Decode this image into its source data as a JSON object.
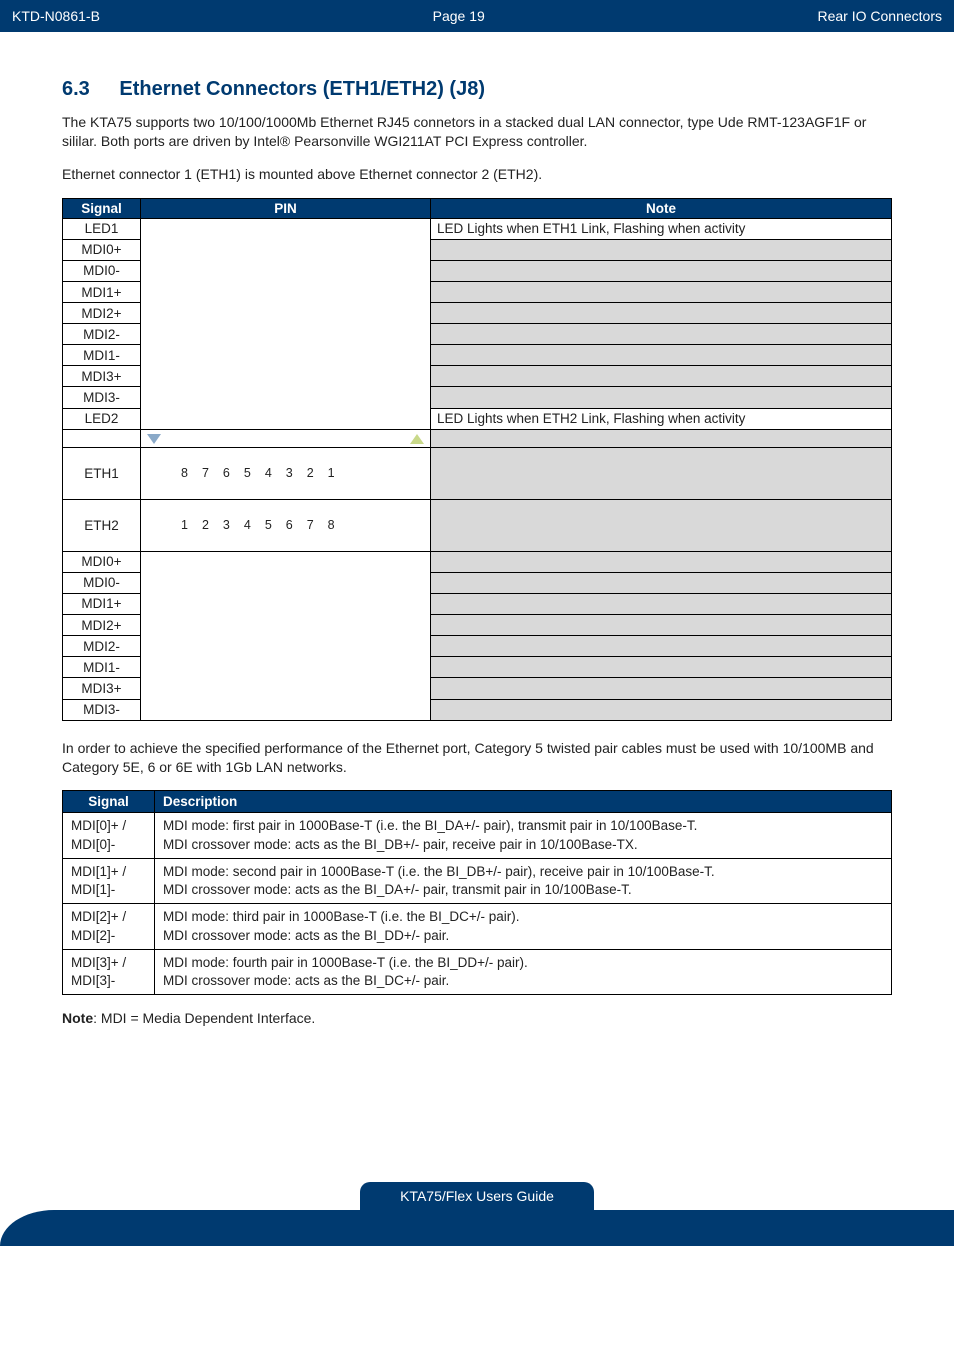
{
  "header": {
    "doc_code": "KTD-N0861-B",
    "page_label": "Page 19",
    "section_title": "Rear IO Connectors"
  },
  "section": {
    "number": "6.3",
    "title": "Ethernet Connectors (ETH1/ETH2) (J8)"
  },
  "intro_p1": "The KTA75 supports two 10/100/1000Mb Ethernet RJ45 connetors in a stacked dual LAN connector, type Ude RMT-123AGF1F or sililar. Both ports are driven by Intel® Pearsonville WGI211AT PCI Express controller.",
  "intro_p2": "Ethernet connector 1 (ETH1) is mounted above Ethernet connector 2 (ETH2).",
  "pin_table": {
    "headers": {
      "signal": "Signal",
      "pin": "PIN",
      "note": "Note"
    },
    "rows_top": [
      {
        "signal": "LED1",
        "note": "LED Lights when ETH1 Link, Flashing when activity",
        "note_light": true
      },
      {
        "signal": "MDI0+",
        "note": ""
      },
      {
        "signal": "MDI0-",
        "note": ""
      },
      {
        "signal": "MDI1+",
        "note": ""
      },
      {
        "signal": "MDI2+",
        "note": ""
      },
      {
        "signal": "MDI2-",
        "note": ""
      },
      {
        "signal": "MDI1-",
        "note": ""
      },
      {
        "signal": "MDI3+",
        "note": ""
      },
      {
        "signal": "MDI3-",
        "note": ""
      },
      {
        "signal": "LED2",
        "note": "LED Lights when ETH2 Link, Flashing when activity",
        "note_light": true
      }
    ],
    "arrow_row_label": "",
    "eth1": {
      "label": "ETH1",
      "pins": [
        "8",
        "7",
        "6",
        "5",
        "4",
        "3",
        "2",
        "1"
      ]
    },
    "eth2": {
      "label": "ETH2",
      "pins": [
        "1",
        "2",
        "3",
        "4",
        "5",
        "6",
        "7",
        "8"
      ]
    },
    "rows_bottom": [
      {
        "signal": "MDI0+",
        "note": ""
      },
      {
        "signal": "MDI0-",
        "note": ""
      },
      {
        "signal": "MDI1+",
        "note": ""
      },
      {
        "signal": "MDI2+",
        "note": ""
      },
      {
        "signal": "MDI2-",
        "note": ""
      },
      {
        "signal": "MDI1-",
        "note": ""
      },
      {
        "signal": "MDI3+",
        "note": ""
      },
      {
        "signal": "MDI3-",
        "note": ""
      }
    ]
  },
  "after_table_p": "In order to achieve the specified performance of the Ethernet port, Category 5 twisted pair cables must be used with 10/100MB and Category 5E, 6 or 6E with 1Gb LAN networks.",
  "desc_table": {
    "headers": {
      "signal": "Signal",
      "description": "Description"
    },
    "rows": [
      {
        "signal_a": "MDI[0]+ /",
        "signal_b": "MDI[0]-",
        "line1": "MDI mode: first pair in 1000Base-T (i.e. the BI_DA+/- pair), transmit pair in 10/100Base-T.",
        "line2": "MDI crossover mode: acts as the BI_DB+/- pair, receive pair in 10/100Base-TX."
      },
      {
        "signal_a": "MDI[1]+ /",
        "signal_b": "MDI[1]-",
        "line1": "MDI mode: second pair in 1000Base-T (i.e. the BI_DB+/- pair), receive pair in 10/100Base-T.",
        "line2": "MDI crossover mode: acts as the BI_DA+/- pair, transmit pair in 10/100Base-T."
      },
      {
        "signal_a": "MDI[2]+ /",
        "signal_b": "MDI[2]-",
        "line1": "MDI mode: third pair in 1000Base-T (i.e. the BI_DC+/- pair).",
        "line2": "MDI crossover mode: acts as the BI_DD+/- pair."
      },
      {
        "signal_a": "MDI[3]+ /",
        "signal_b": "MDI[3]-",
        "line1": "MDI mode: fourth pair in 1000Base-T (i.e. the BI_DD+/- pair).",
        "line2": "MDI crossover mode: acts as the BI_DC+/- pair."
      }
    ]
  },
  "note_label": "Note",
  "note_text": ": MDI = Media Dependent Interface.",
  "footer": "KTA75/Flex Users Guide"
}
